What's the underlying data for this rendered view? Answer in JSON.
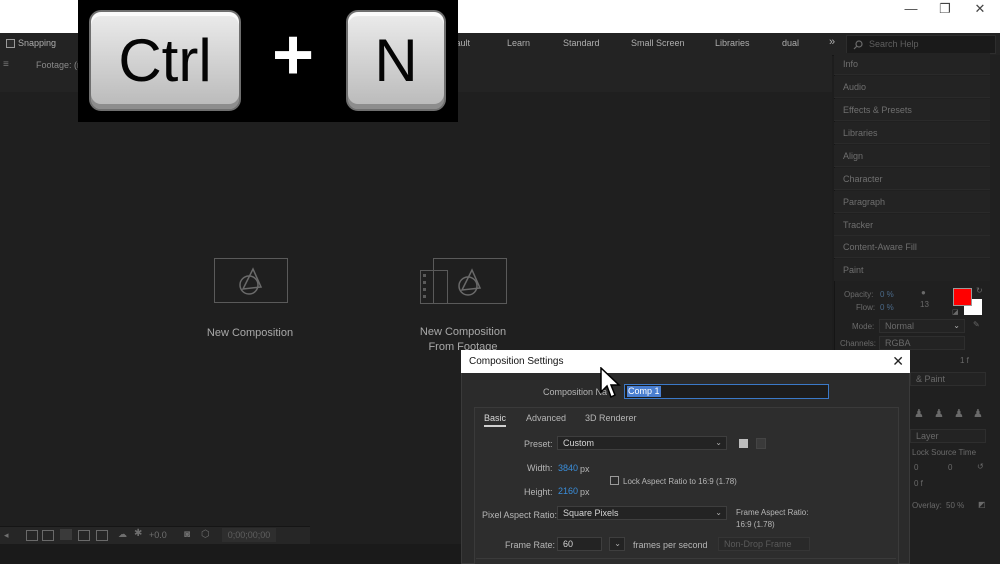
{
  "window": {
    "minimize": "—",
    "restore": "❐",
    "close": "✕"
  },
  "workspace": {
    "snapping": "Snapping",
    "items": [
      "efault",
      "Learn",
      "Standard",
      "Small Screen",
      "Libraries",
      "dual"
    ],
    "overflow": "»",
    "search_placeholder": "Search Help"
  },
  "footage_tab": "Footage: (n",
  "cards": [
    {
      "label": "New Composition"
    },
    {
      "label_line1": "New Composition",
      "label_line2": "From Footage"
    }
  ],
  "bottom_bar": {
    "plus_value": "+0.0",
    "timecode": "0;00;00;00"
  },
  "right_panel": {
    "items": [
      "Info",
      "Audio",
      "Effects & Presets",
      "Libraries",
      "Align",
      "Character",
      "Paragraph",
      "Tracker",
      "Content-Aware Fill",
      "Paint"
    ],
    "paint": {
      "opacity_label": "Opacity:",
      "opacity_value": "0 %",
      "flow_label": "Flow:",
      "flow_value": "0 %",
      "brush_size": "13",
      "mode_label": "Mode:",
      "mode_value": "Normal",
      "channels_label": "Channels:",
      "channels_value": "RGBA",
      "duration_value": "& Paint",
      "spacing": "1 f",
      "lock_source_time": "Lock Source Time",
      "val_a": "0",
      "val_b": "0",
      "val_f": "0 f",
      "clone_source": "Layer",
      "overlay_label": "Overlay:",
      "overlay_value": "50 %",
      "foreground_color": "#ff0000",
      "background_color": "#ffffff"
    }
  },
  "shortcut": {
    "key1": "Ctrl",
    "plus": "+",
    "key2": "N"
  },
  "dialog": {
    "title": "Composition Settings",
    "close": "✕",
    "comp_name_label": "Composition Na",
    "comp_name_value": "Comp 1",
    "tabs": [
      "Basic",
      "Advanced",
      "3D Renderer"
    ],
    "preset_label": "Preset:",
    "preset_value": "Custom",
    "width_label": "Width:",
    "width_value": "3840",
    "width_unit": "px",
    "height_label": "Height:",
    "height_value": "2160",
    "height_unit": "px",
    "lock_aspect": "Lock Aspect Ratio to 16:9 (1.78)",
    "par_label": "Pixel Aspect Ratio:",
    "par_value": "Square Pixels",
    "frame_aspect_label": "Frame Aspect Ratio:",
    "frame_aspect_value": "16:9 (1.78)",
    "frame_rate_label": "Frame Rate:",
    "frame_rate_value": "60",
    "fps_label": "frames per second",
    "drop_frame": "Non-Drop Frame"
  }
}
